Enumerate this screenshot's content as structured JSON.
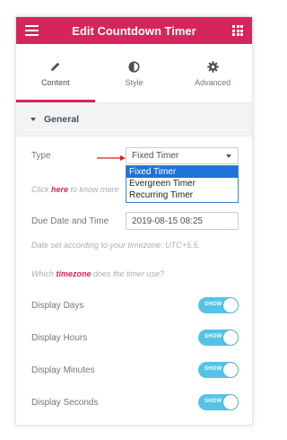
{
  "header": {
    "title": "Edit Countdown Timer"
  },
  "tabs": [
    {
      "label": "Content",
      "icon": "pencil-icon"
    },
    {
      "label": "Style",
      "icon": "half-circle-icon"
    },
    {
      "label": "Advanced",
      "icon": "gear-icon"
    }
  ],
  "section": {
    "title": "General"
  },
  "type_field": {
    "label": "Type",
    "value": "Fixed Timer",
    "options": [
      "Fixed Timer",
      "Evergreen Timer",
      "Recurring Timer"
    ]
  },
  "help1": {
    "prefix": "Click ",
    "link": "here",
    "suffix": " to know more"
  },
  "due_date": {
    "label": "Due Date and Time",
    "value": "2019-08-15 08:25"
  },
  "timezone_note": "Date set according to your timezone: UTC+5.5.",
  "help2": {
    "prefix": "Which ",
    "link": "timezone",
    "suffix": " does the timer use?"
  },
  "toggles": [
    {
      "label": "Display Days",
      "state": "SHOW"
    },
    {
      "label": "Display Hours",
      "state": "SHOW"
    },
    {
      "label": "Display Minutes",
      "state": "SHOW"
    },
    {
      "label": "Display Seconds",
      "state": "SHOW"
    }
  ],
  "colors": {
    "accent": "#d5265c",
    "toggle": "#55c3e6",
    "select_highlight": "#1e73d8",
    "indicator_arrow": "#e21b1b"
  }
}
